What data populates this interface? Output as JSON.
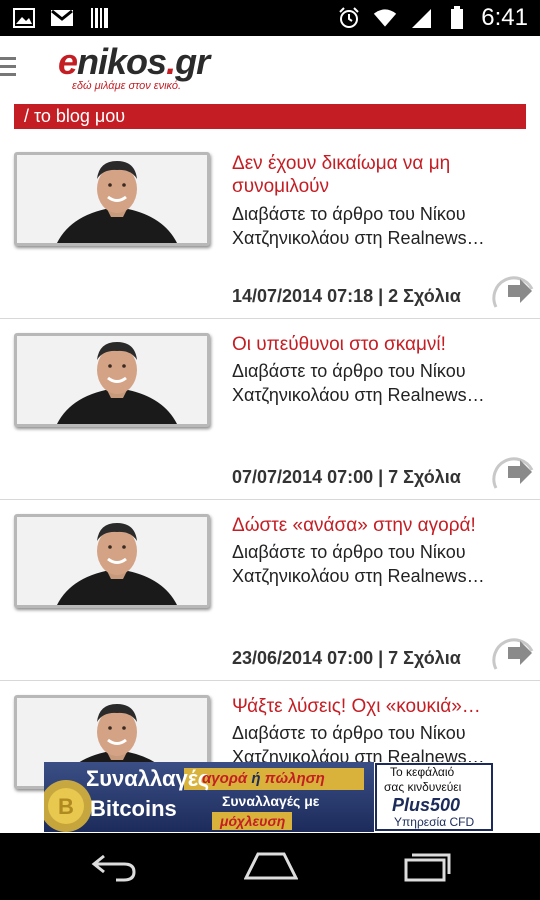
{
  "status_bar": {
    "time": "6:41",
    "icons": [
      "image-notification-icon",
      "gmail-icon",
      "barcode-notification-icon",
      "alarm-icon",
      "wifi-icon",
      "signal-icon",
      "battery-icon"
    ]
  },
  "app_bar": {
    "logo_word_en": "e",
    "logo_word_ikos": "nikos",
    "logo_word_dot": ".",
    "logo_word_gr": "gr",
    "tagline": "εδώ μιλάμε στον ενικό."
  },
  "section": {
    "title": "/ το blog μου"
  },
  "articles": [
    {
      "title": "Δεν έχουν δικαίωμα να μη συνομιλούν",
      "excerpt_line1": "Διαβάστε το άρθρο του Νίκου",
      "excerpt_line2": "Χατζηνικολάου στη Realnews…",
      "meta": "14/07/2014 07:18 | 2 Σχόλια"
    },
    {
      "title": "Οι υπεύθυνοι στο σκαμνί!",
      "excerpt_line1": "Διαβάστε το άρθρο του Νίκου",
      "excerpt_line2": "Χατζηνικολάου στη Realnews…",
      "meta": "07/07/2014 07:00 | 7 Σχόλια"
    },
    {
      "title": "Δώστε «ανάσα» στην αγορά!",
      "excerpt_line1": "Διαβάστε το άρθρο του Νίκου",
      "excerpt_line2": "Χατζηνικολάου στη Realnews…",
      "meta": "23/06/2014 07:00 | 7 Σχόλια"
    },
    {
      "title": "Ψάξτε λύσεις! Οχι «κουκιά»…",
      "excerpt_line1": "Διαβάστε το άρθρο του Νίκου",
      "excerpt_line2": "Χατζηνικολάου στη Realnews…",
      "meta": ""
    }
  ],
  "ad": {
    "headline1": "Συναλλαγές",
    "headline2": "Bitcoins",
    "offer_agora": "αγορά",
    "offer_or": "ή",
    "offer_poulisi": "πώληση",
    "line2": "Συναλλαγές με",
    "line3": "μόχλευση",
    "risk1": "Το κεφάλαιό",
    "risk2": "σας κινδυνεύει",
    "brand": "Plus500",
    "service": "Υπηρεσία CFD"
  },
  "colors": {
    "brand_red": "#c41e24",
    "status_bar": "#000000",
    "nav_bar": "#000000"
  }
}
